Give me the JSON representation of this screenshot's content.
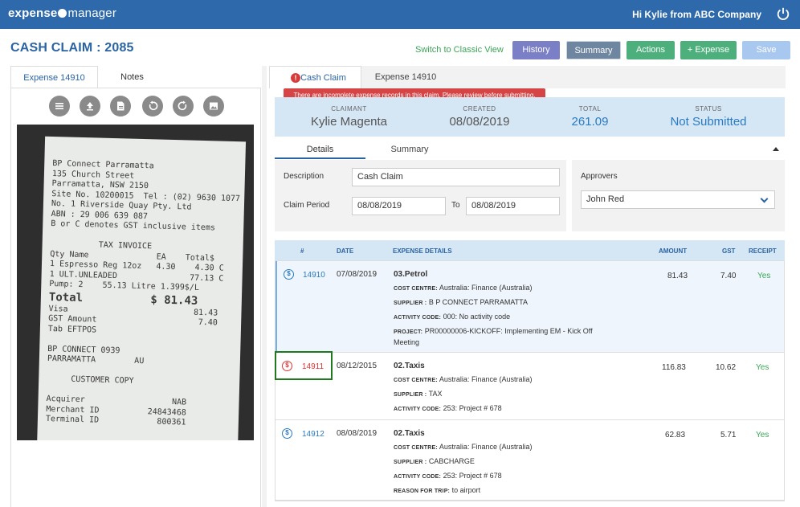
{
  "app": {
    "logo_left": "expense",
    "logo_right": "manager",
    "greeting": "Hi Kylie from ABC Company"
  },
  "header": {
    "title": "CASH CLAIM : 2085",
    "classic_link": "Switch to Classic View",
    "buttons": {
      "history": "History",
      "summary": "Summary",
      "actions": "Actions",
      "expense": "+ Expense",
      "save": "Save"
    }
  },
  "left_panel": {
    "tabs": [
      "Expense 14910",
      "Notes"
    ],
    "tools": [
      "list-icon",
      "upload-icon",
      "document-icon",
      "rotate-left-icon",
      "rotate-right-icon",
      "image-icon"
    ],
    "receipt_lines": [
      "BP Connect Parramatta",
      "135 Church Street",
      "Parramatta, NSW 2150",
      "Site No. 10200015  Tel : (02) 9630 1077",
      "No. 1 Riverside Quay Pty. Ltd",
      "ABN : 29 006 639 087",
      "B or C denotes GST inclusive items",
      "",
      "          TAX INVOICE",
      "Qty Name              EA    Total$",
      "1 Espresso Reg 12oz   4.30    4.30 C",
      "1 ULT.UNLEADED               77.13 C",
      "Pump: 2    55.13 Litre 1.399$/L"
    ],
    "receipt_total_label": "Total",
    "receipt_total_value": "$ 81.43",
    "receipt_lines_2": [
      "Visa                          81.43",
      "GST Amount                     7.40",
      "Tab EFTPOS",
      "",
      "BP CONNECT 0939",
      "PARRAMATTA        AU",
      "",
      "     CUSTOMER COPY",
      "",
      "Acquirer                  NAB",
      "Merchant ID          24843468",
      "Terminal ID            800361"
    ]
  },
  "right_panel": {
    "tabs": [
      "Cash Claim",
      "Expense 14910"
    ],
    "alert_icon": "!",
    "error_message": "There are incomplete expense records in this claim. Please review before submitting.",
    "summary": {
      "claimant_label": "CLAIMANT",
      "claimant": "Kylie Magenta",
      "created_label": "CREATED",
      "created": "08/08/2019",
      "total_label": "TOTAL",
      "total": "261.09",
      "status_label": "STATUS",
      "status": "Not Submitted"
    },
    "sub_tabs": [
      "Details",
      "Summary"
    ],
    "form": {
      "description_label": "Description",
      "description_value": "Cash Claim",
      "period_label": "Claim Period",
      "period_from": "08/08/2019",
      "to_label": "To",
      "period_to": "08/08/2019",
      "approvers_label": "Approvers",
      "approver": "John Red"
    },
    "table": {
      "headers": [
        "#",
        "DATE",
        "EXPENSE DETAILS",
        "AMOUNT",
        "GST",
        "RECEIPT"
      ],
      "rows": [
        {
          "id": "14910",
          "date": "07/08/2019",
          "type": "03.Petrol",
          "cost_centre_label": "COST CENTRE:",
          "cost_centre": "Australia: Finance (Australia)",
          "supplier_label": "SUPPLIER :",
          "supplier": "B P CONNECT PARRAMATTA",
          "activity_label": "ACTIVITY CODE:",
          "activity": "000: No activity code",
          "project_label": "PROJECT:",
          "project": "PR00000006-KICKOFF:  Implementing EM - Kick Off",
          "project_cont": "Meeting",
          "amount": "81.43",
          "gst": "7.40",
          "receipt": "Yes"
        },
        {
          "id": "14911",
          "date": "08/12/2015",
          "type": "02.Taxis",
          "cost_centre_label": "COST CENTRE:",
          "cost_centre": "Australia: Finance (Australia)",
          "supplier_label": "SUPPLIER :",
          "supplier": "TAX",
          "activity_label": "ACTIVITY CODE:",
          "activity": "253: Project # 678",
          "amount": "116.83",
          "gst": "10.62",
          "receipt": "Yes"
        },
        {
          "id": "14912",
          "date": "08/08/2019",
          "type": "02.Taxis",
          "cost_centre_label": "COST CENTRE:",
          "cost_centre": "Australia: Finance (Australia)",
          "supplier_label": "SUPPLIER :",
          "supplier": "CABCHARGE",
          "activity_label": "ACTIVITY CODE:",
          "activity": "253: Project # 678",
          "reason_label": "REASON FOR TRIP:",
          "reason": "to airport",
          "amount": "62.83",
          "gst": "5.71",
          "receipt": "Yes"
        }
      ]
    }
  },
  "colors": {
    "brand": "#2e6aab",
    "accent_green": "#4caf7c",
    "error_red": "#d64545",
    "summary_blue": "#d5e6f5"
  }
}
